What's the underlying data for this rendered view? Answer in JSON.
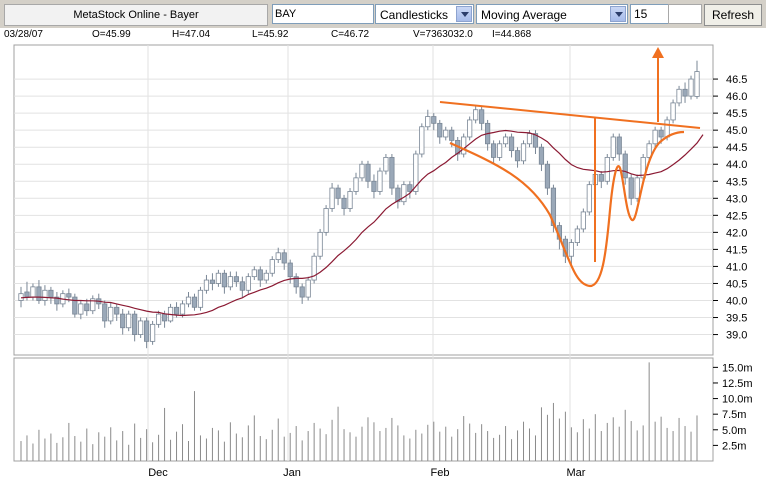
{
  "toolbar": {
    "app_title": "MetaStock Online - Bayer",
    "symbol": "BAY",
    "chart_type": "Candlesticks",
    "study": "Moving Average",
    "period": "15",
    "refresh_label": "Refresh"
  },
  "info": {
    "date": "03/28/07",
    "open": "O=45.99",
    "high": "H=47.04",
    "low": "L=45.92",
    "close": "C=46.72",
    "volume": "V=7363032.0",
    "indicator": "I=44.868"
  },
  "colors": {
    "candle_body": "#9aa8b8",
    "candle_wick": "#7a8796",
    "moving_average": "#8b1a33",
    "annotation": "#f07020",
    "grid": "#e2e2e2",
    "volume": "#8a8a8a"
  },
  "chart_data": {
    "type": "candlestick",
    "price_ticks": [
      "46.5",
      "46.0",
      "45.5",
      "45.0",
      "44.5",
      "44.0",
      "43.5",
      "43.0",
      "42.5",
      "42.0",
      "41.5",
      "41.0",
      "40.5",
      "40.0",
      "39.5",
      "39.0"
    ],
    "volume_ticks": [
      "15.0m",
      "12.5m",
      "10.0m",
      "7.5m",
      "5.0m",
      "2.5m"
    ],
    "month_labels": [
      "Dec",
      "Jan",
      "Feb",
      "Mar"
    ],
    "price_range": [
      38.4,
      47.5
    ],
    "volume_range": [
      0,
      16500000
    ],
    "candles": [
      [
        40.0,
        40.2,
        39.8,
        40.4
      ],
      [
        40.25,
        40.1,
        40.0,
        40.55
      ],
      [
        40.1,
        40.4,
        40.0,
        40.5
      ],
      [
        40.4,
        40.0,
        39.9,
        40.6
      ],
      [
        40.0,
        40.3,
        39.85,
        40.45
      ],
      [
        40.3,
        40.1,
        39.9,
        40.4
      ],
      [
        40.1,
        39.9,
        39.7,
        40.25
      ],
      [
        39.9,
        40.2,
        39.8,
        40.3
      ],
      [
        40.2,
        40.1,
        39.95,
        40.35
      ],
      [
        40.1,
        39.6,
        39.5,
        40.2
      ],
      [
        39.6,
        39.9,
        39.45,
        40.0
      ],
      [
        39.9,
        39.7,
        39.55,
        40.05
      ],
      [
        39.7,
        40.05,
        39.6,
        40.15
      ],
      [
        40.05,
        39.9,
        39.75,
        40.2
      ],
      [
        39.9,
        39.4,
        39.2,
        40.0
      ],
      [
        39.4,
        39.8,
        39.3,
        39.95
      ],
      [
        39.8,
        39.6,
        39.4,
        39.9
      ],
      [
        39.6,
        39.2,
        39.0,
        39.75
      ],
      [
        39.2,
        39.6,
        39.1,
        39.7
      ],
      [
        39.6,
        39.0,
        38.8,
        39.7
      ],
      [
        39.0,
        39.4,
        38.9,
        39.5
      ],
      [
        39.4,
        38.8,
        38.6,
        39.5
      ],
      [
        38.8,
        39.3,
        38.7,
        39.4
      ],
      [
        39.3,
        39.6,
        39.2,
        39.7
      ],
      [
        39.6,
        39.4,
        39.2,
        39.7
      ],
      [
        39.4,
        39.8,
        39.35,
        39.9
      ],
      [
        39.8,
        39.6,
        39.5,
        39.95
      ],
      [
        39.6,
        39.9,
        39.5,
        40.0
      ],
      [
        39.9,
        40.1,
        39.8,
        40.25
      ],
      [
        40.1,
        39.8,
        39.7,
        40.2
      ],
      [
        39.8,
        40.3,
        39.7,
        40.4
      ],
      [
        40.3,
        40.6,
        40.2,
        40.75
      ],
      [
        40.6,
        40.5,
        40.3,
        40.8
      ],
      [
        40.5,
        40.8,
        40.4,
        40.9
      ],
      [
        40.8,
        40.4,
        40.2,
        40.9
      ],
      [
        40.4,
        40.7,
        40.3,
        40.85
      ],
      [
        40.7,
        40.55,
        40.4,
        40.85
      ],
      [
        40.55,
        40.3,
        40.1,
        40.7
      ],
      [
        40.3,
        40.7,
        40.2,
        40.8
      ],
      [
        40.7,
        40.9,
        40.6,
        41.0
      ],
      [
        40.9,
        40.6,
        40.4,
        41.0
      ],
      [
        40.6,
        40.8,
        40.5,
        40.9
      ],
      [
        40.8,
        41.2,
        40.7,
        41.3
      ],
      [
        41.2,
        41.4,
        41.1,
        41.55
      ],
      [
        41.4,
        41.1,
        40.9,
        41.5
      ],
      [
        41.1,
        40.7,
        40.5,
        41.2
      ],
      [
        40.7,
        40.4,
        40.2,
        40.8
      ],
      [
        40.4,
        40.1,
        39.9,
        40.5
      ],
      [
        40.1,
        40.6,
        40.0,
        40.7
      ],
      [
        40.6,
        41.3,
        40.5,
        41.4
      ],
      [
        41.3,
        42.0,
        41.2,
        42.1
      ],
      [
        42.0,
        42.7,
        41.9,
        42.8
      ],
      [
        42.7,
        43.3,
        42.6,
        43.45
      ],
      [
        43.3,
        43.0,
        42.8,
        43.4
      ],
      [
        43.0,
        42.7,
        42.5,
        43.1
      ],
      [
        42.7,
        43.2,
        42.6,
        43.3
      ],
      [
        43.2,
        43.6,
        43.1,
        43.75
      ],
      [
        43.6,
        44.0,
        43.5,
        44.1
      ],
      [
        44.0,
        43.5,
        43.3,
        44.1
      ],
      [
        43.5,
        43.2,
        43.0,
        43.7
      ],
      [
        43.2,
        43.8,
        43.1,
        43.9
      ],
      [
        43.8,
        44.2,
        43.7,
        44.3
      ],
      [
        44.2,
        43.3,
        43.1,
        44.3
      ],
      [
        43.3,
        42.9,
        42.7,
        43.4
      ],
      [
        42.9,
        43.4,
        42.8,
        43.5
      ],
      [
        43.4,
        43.2,
        43.0,
        43.5
      ],
      [
        43.2,
        44.3,
        43.1,
        44.4
      ],
      [
        44.3,
        45.1,
        44.2,
        45.2
      ],
      [
        45.1,
        45.4,
        45.0,
        45.6
      ],
      [
        45.4,
        45.2,
        45.0,
        45.5
      ],
      [
        45.2,
        44.8,
        44.6,
        45.3
      ],
      [
        44.8,
        45.0,
        44.7,
        45.1
      ],
      [
        45.0,
        44.7,
        44.5,
        45.1
      ],
      [
        44.7,
        44.3,
        44.1,
        44.8
      ],
      [
        44.3,
        44.8,
        44.2,
        44.9
      ],
      [
        44.8,
        45.3,
        44.7,
        45.4
      ],
      [
        45.3,
        45.6,
        45.2,
        45.7
      ],
      [
        45.6,
        45.2,
        45.0,
        45.7
      ],
      [
        45.2,
        44.6,
        44.4,
        45.3
      ],
      [
        44.6,
        44.2,
        44.0,
        44.7
      ],
      [
        44.2,
        44.6,
        44.1,
        44.7
      ],
      [
        44.6,
        44.8,
        44.5,
        44.9
      ],
      [
        44.8,
        44.4,
        44.2,
        44.9
      ],
      [
        44.4,
        44.1,
        43.9,
        44.5
      ],
      [
        44.1,
        44.6,
        44.0,
        44.7
      ],
      [
        44.6,
        44.9,
        44.5,
        45.0
      ],
      [
        44.9,
        44.5,
        44.3,
        45.0
      ],
      [
        44.5,
        44.0,
        43.8,
        44.6
      ],
      [
        44.0,
        43.3,
        43.1,
        44.1
      ],
      [
        43.3,
        42.2,
        42.0,
        43.4
      ],
      [
        42.2,
        41.8,
        41.5,
        42.3
      ],
      [
        41.8,
        41.3,
        41.1,
        41.9
      ],
      [
        41.3,
        41.7,
        41.0,
        41.8
      ],
      [
        41.7,
        42.1,
        41.6,
        42.2
      ],
      [
        42.1,
        42.6,
        42.0,
        42.7
      ],
      [
        42.6,
        43.4,
        42.5,
        43.5
      ],
      [
        43.4,
        43.7,
        43.3,
        43.8
      ],
      [
        43.7,
        43.5,
        43.3,
        43.8
      ],
      [
        43.5,
        44.2,
        43.4,
        44.3
      ],
      [
        44.2,
        44.8,
        44.1,
        44.9
      ],
      [
        44.8,
        44.3,
        44.1,
        44.9
      ],
      [
        44.3,
        43.6,
        43.4,
        44.4
      ],
      [
        43.6,
        43.0,
        42.8,
        43.7
      ],
      [
        43.0,
        43.6,
        42.9,
        43.7
      ],
      [
        43.6,
        44.2,
        43.5,
        44.3
      ],
      [
        44.2,
        44.6,
        44.1,
        44.7
      ],
      [
        44.6,
        45.0,
        44.5,
        45.1
      ],
      [
        45.0,
        44.8,
        44.6,
        45.1
      ],
      [
        44.8,
        45.3,
        44.7,
        45.4
      ],
      [
        45.3,
        45.8,
        45.2,
        45.9
      ],
      [
        45.8,
        46.2,
        45.7,
        46.3
      ],
      [
        46.2,
        46.0,
        45.8,
        46.4
      ],
      [
        46.0,
        46.5,
        45.9,
        46.6
      ],
      [
        45.99,
        46.72,
        45.92,
        47.04
      ]
    ],
    "volumes": [
      3.2,
      4.1,
      2.8,
      5.0,
      3.6,
      4.4,
      2.9,
      3.8,
      6.1,
      4.0,
      3.1,
      5.2,
      2.7,
      4.6,
      3.9,
      5.4,
      3.3,
      4.8,
      2.6,
      6.0,
      3.7,
      5.1,
      3.0,
      4.2,
      8.5,
      3.4,
      4.7,
      5.9,
      3.2,
      11.2,
      4.1,
      3.6,
      5.3,
      4.9,
      3.1,
      6.2,
      4.4,
      3.8,
      5.7,
      7.3,
      4.0,
      3.5,
      5.0,
      6.8,
      3.9,
      4.5,
      5.6,
      3.3,
      4.8,
      6.1,
      5.2,
      4.3,
      6.6,
      8.7,
      5.1,
      4.6,
      3.9,
      5.5,
      7.0,
      6.2,
      4.8,
      5.3,
      6.9,
      5.7,
      4.1,
      3.6,
      5.0,
      4.4,
      5.8,
      6.3,
      4.7,
      5.5,
      3.9,
      5.1,
      7.2,
      6.0,
      4.5,
      5.9,
      4.8,
      3.7,
      4.2,
      5.6,
      3.5,
      4.9,
      6.3,
      5.2,
      4.1,
      8.6,
      7.4,
      9.3,
      6.8,
      7.9,
      5.4,
      4.6,
      6.7,
      5.2,
      7.5,
      4.8,
      6.1,
      7.0,
      5.5,
      8.2,
      6.4,
      4.9,
      5.7,
      15.8,
      6.3,
      7.1,
      5.3,
      4.8,
      6.9,
      5.6,
      4.7,
      7.3
    ],
    "moving_average": [
      40.08,
      40.09,
      40.1,
      40.1,
      40.09,
      40.08,
      40.07,
      40.04,
      40.02,
      40.0,
      40.0,
      39.99,
      39.99,
      39.98,
      39.95,
      39.94,
      39.9,
      39.86,
      39.82,
      39.77,
      39.73,
      39.69,
      39.66,
      39.65,
      39.61,
      39.59,
      39.57,
      39.56,
      39.57,
      39.58,
      39.61,
      39.65,
      39.71,
      39.8,
      39.86,
      39.94,
      40.02,
      40.08,
      40.18,
      40.24,
      40.31,
      40.36,
      40.43,
      40.52,
      40.59,
      40.63,
      40.65,
      40.65,
      40.67,
      40.72,
      40.83,
      40.97,
      41.14,
      41.32,
      41.46,
      41.61,
      41.79,
      42.0,
      42.16,
      42.3,
      42.49,
      42.69,
      42.82,
      42.93,
      43.03,
      43.15,
      43.35,
      43.55,
      43.71,
      43.81,
      43.94,
      44.05,
      44.2,
      44.32,
      44.46,
      44.6,
      44.74,
      44.85,
      44.9,
      44.93,
      44.97,
      44.99,
      44.97,
      44.94,
      44.93,
      44.92,
      44.86,
      44.77,
      44.66,
      44.48,
      44.32,
      44.14,
      43.99,
      43.9,
      43.85,
      43.83,
      43.81,
      43.77,
      43.78,
      43.81,
      43.82,
      43.79,
      43.72,
      43.67,
      43.68,
      43.7,
      43.74,
      43.78,
      43.87,
      43.99,
      44.12,
      44.27,
      44.44,
      44.62,
      44.87
    ]
  }
}
